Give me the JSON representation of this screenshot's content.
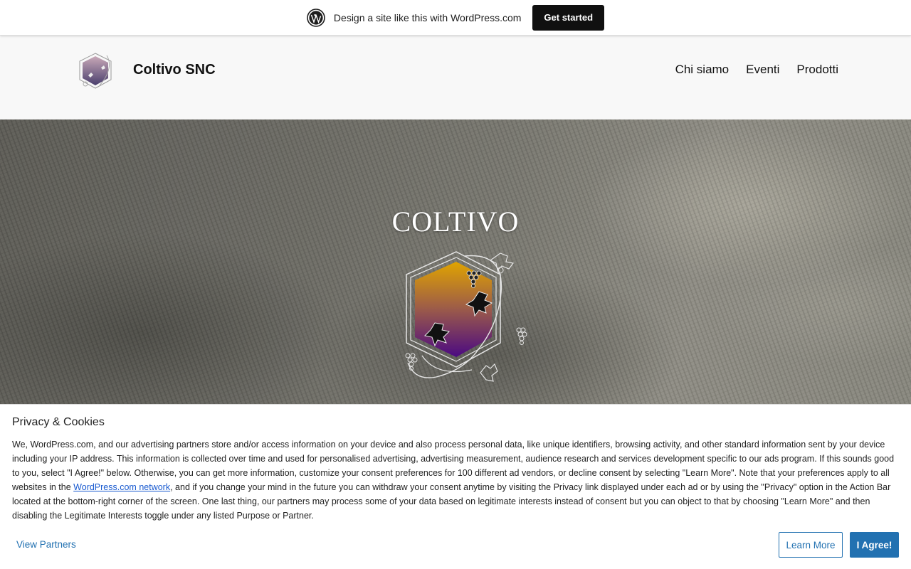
{
  "wpbar": {
    "text": "Design a site like this with WordPress.com",
    "cta": "Get started"
  },
  "header": {
    "site_title": "Coltivo SNC",
    "nav": [
      "Chi siamo",
      "Eventi",
      "Prodotti"
    ]
  },
  "hero": {
    "title": "COLTIVO"
  },
  "privacy": {
    "title": "Privacy & Cookies",
    "text_before_link": "We, WordPress.com, and our advertising partners store and/or access information on your device and also process personal data, like unique identifiers, browsing activity, and other standard information sent by your device including your IP address. This information is collected over time and used for personalised advertising, advertising measurement, audience research and services development specific to our ads program. If this sounds good to you, select \"I Agree!\" below. Otherwise, you can get more information, customize your consent preferences for 100 different ad vendors, or decline consent by selecting \"Learn More\". Note that your preferences apply to all websites in the ",
    "link_text": "WordPress.com network",
    "text_after_link": ", and if you change your mind in the future you can withdraw your consent anytime by visiting the Privacy link displayed under each ad or by using the \"Privacy\" option in the Action Bar located at the bottom-right corner of the screen. One last thing, our partners may process some of your data based on legitimate interests instead of consent but you can object to that by choosing \"Learn More\" and then disabling the Legitimate Interests toggle under any listed Purpose or Partner.",
    "view_partners": "View Partners",
    "learn_more": "Learn More",
    "agree": "I Agree!"
  },
  "colors": {
    "accent": "#2271b1",
    "dark_button": "#101010",
    "emblem_top": "#e0a400",
    "emblem_bottom": "#4b0a82"
  },
  "icons": [
    "wordpress-logo-icon",
    "site-logo-icon",
    "coltivo-emblem-icon"
  ]
}
